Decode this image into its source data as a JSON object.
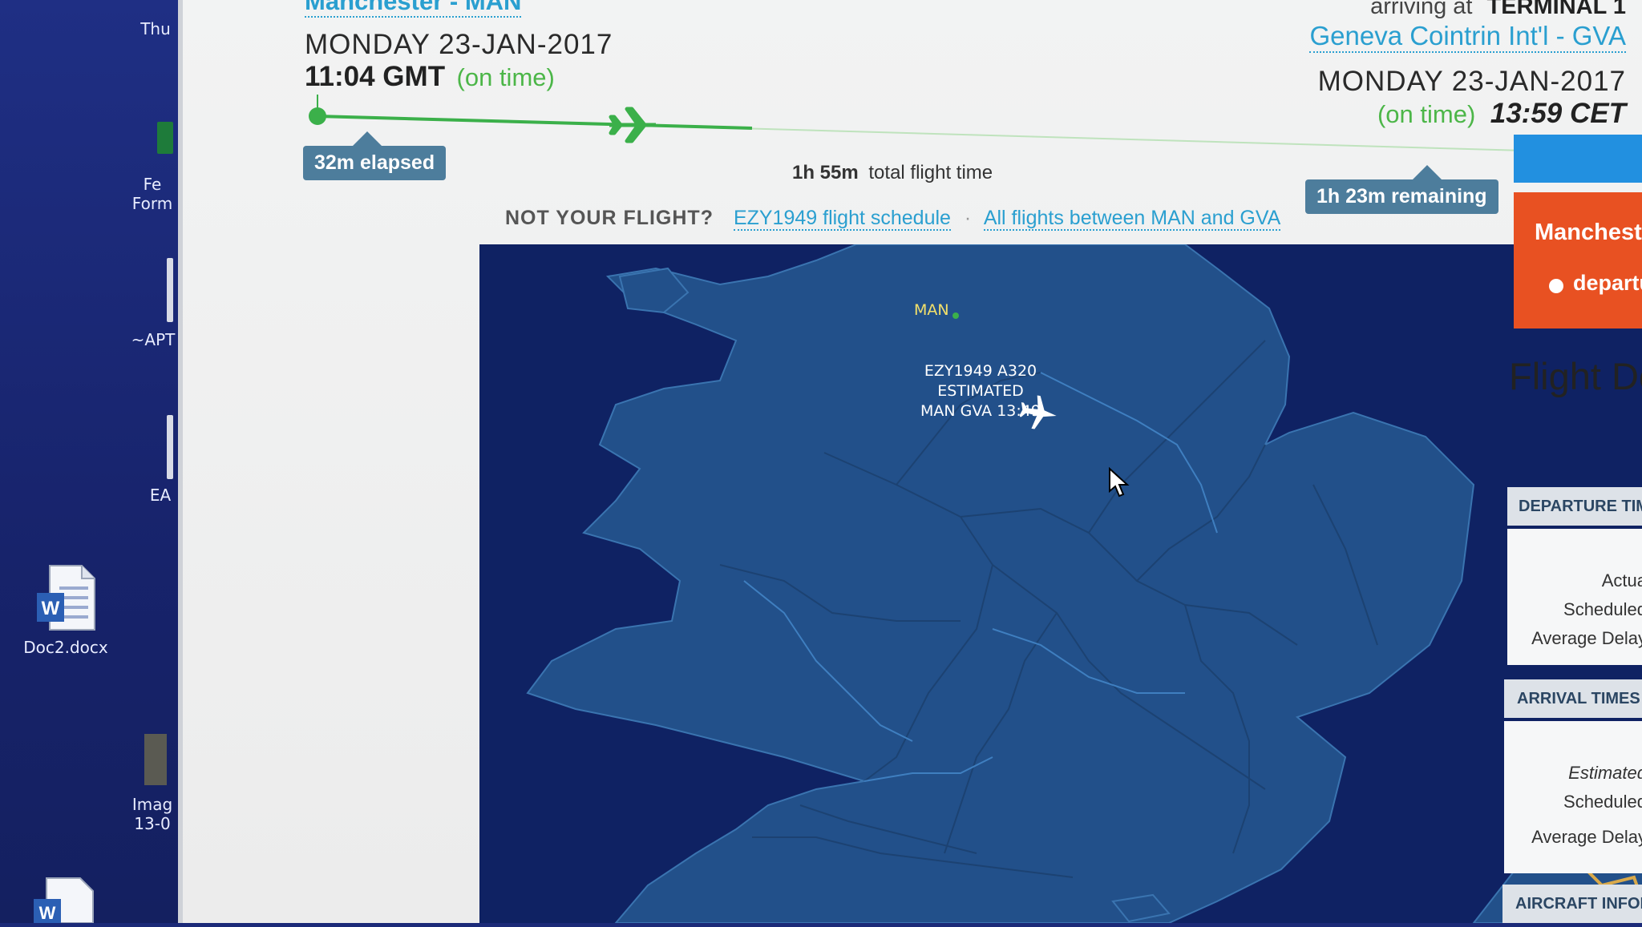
{
  "desktop": {
    "items": [
      {
        "label": "Thu"
      },
      {
        "label": "Fe\nForm"
      },
      {
        "label": "~APT"
      },
      {
        "label": "EA"
      },
      {
        "label": "Doc2.docx"
      },
      {
        "label": "Imag\n13-0"
      }
    ]
  },
  "flight": {
    "origin_link": "Manchester - MAN",
    "departure": {
      "date": "MONDAY 23-JAN-2017",
      "time": "11:04 GMT",
      "status": "(on time)"
    },
    "arriving_prefix": "arriving at",
    "terminal": "TERMINAL 1",
    "destination_link": "Geneva Cointrin Int'l - GVA",
    "arrival": {
      "date": "MONDAY 23-JAN-2017",
      "status": "(on time)",
      "time": "13:59 CET"
    },
    "progress": {
      "elapsed": "32m elapsed",
      "total": "1h 55m",
      "total_suffix": "total flight time",
      "remaining": "1h 23m remaining",
      "fraction": 0.28
    },
    "not_your_flight": "NOT YOUR FLIGHT?",
    "schedule_link": "EZY1949 flight schedule",
    "separator": "·",
    "between_link": "All flights between MAN and GVA"
  },
  "map": {
    "airport_label": "MAN",
    "flight_label_line1": "EZY1949 A320",
    "flight_label_line2": "ESTIMATED",
    "flight_label_line3": "MAN GVA 13:49",
    "colors": {
      "sea": "#0f2263",
      "land": "#22508a",
      "track": "#3bb04a",
      "marker": "#ffffff"
    }
  },
  "right_panel": {
    "origin_banner": "Manchester",
    "departure_tag": "departu",
    "title": "Flight De",
    "departure_times_header": "DEPARTURE TIM",
    "actual": "Actua",
    "scheduled": "Scheduled",
    "average_delay": "Average Delay",
    "arrival_times_header": "ARRIVAL TIMES",
    "estimated": "Estimated",
    "scheduled2": "Scheduled",
    "average_delay2": "Average Delay",
    "aircraft_header": "AIRCRAFT INFOR"
  }
}
